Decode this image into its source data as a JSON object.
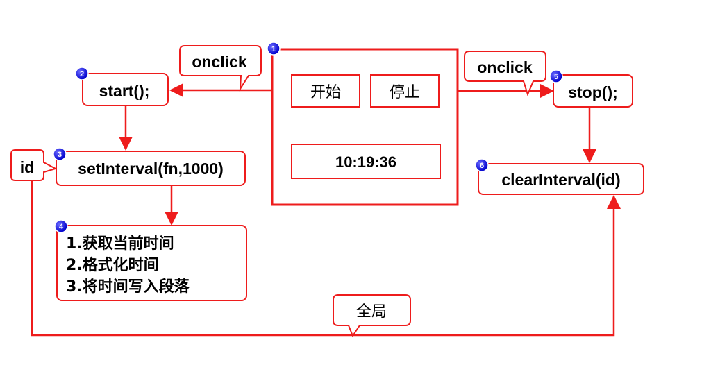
{
  "callouts": {
    "onclick_left": "onclick",
    "onclick_right": "onclick",
    "global": "全局"
  },
  "panel": {
    "start_button": "开始",
    "stop_button": "停止",
    "time_display": "10:19:36"
  },
  "nodes": {
    "start_fn": "start();",
    "set_interval": "setInterval(fn,1000)",
    "id_var": "id",
    "steps": [
      "1.获取当前时间",
      "2.格式化时间",
      "3.将时间写入段落"
    ],
    "stop_fn": "stop();",
    "clear_interval": "clearInterval(id)"
  },
  "badges": {
    "b1": "1",
    "b2": "2",
    "b3": "3",
    "b4": "4",
    "b5": "5",
    "b6": "6"
  },
  "colors": {
    "accent": "#ee1c1c",
    "badge": "#1a1aff"
  }
}
